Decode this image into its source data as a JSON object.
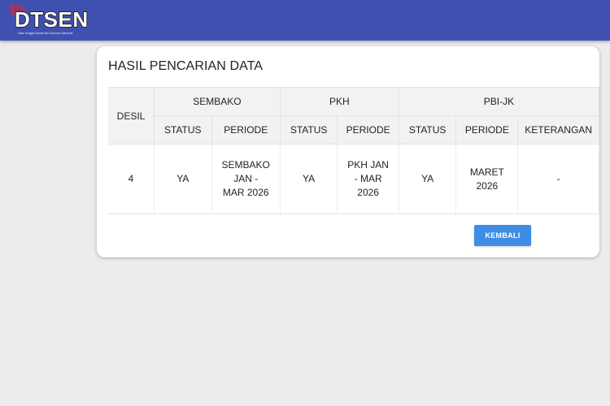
{
  "header": {
    "logo_text": "DTSEN",
    "logo_tagline": "Data Tunggal Sosial dan Ekonomi Nasional",
    "brand_color": "#4050b1",
    "logo_accent_color": "#d8242f"
  },
  "card": {
    "title": "HASIL PENCARIAN DATA"
  },
  "table": {
    "col_desil": "DESIL",
    "groups": {
      "sembako": "SEMBAKO",
      "pkh": "PKH",
      "pbijk": "PBI-JK"
    },
    "sub": {
      "status": "STATUS",
      "periode": "PERIODE",
      "keterangan": "KETERANGAN"
    },
    "rows": [
      {
        "desil": "4",
        "sembako_status": "YA",
        "sembako_periode": "SEMBAKO JAN - MAR 2026",
        "pkh_status": "YA",
        "pkh_periode": "PKH JAN - MAR 2026",
        "pbijk_status": "YA",
        "pbijk_periode": "MARET 2026",
        "keterangan": "-"
      }
    ]
  },
  "actions": {
    "back_label": "KEMBALI",
    "button_color": "#3e8de4"
  }
}
